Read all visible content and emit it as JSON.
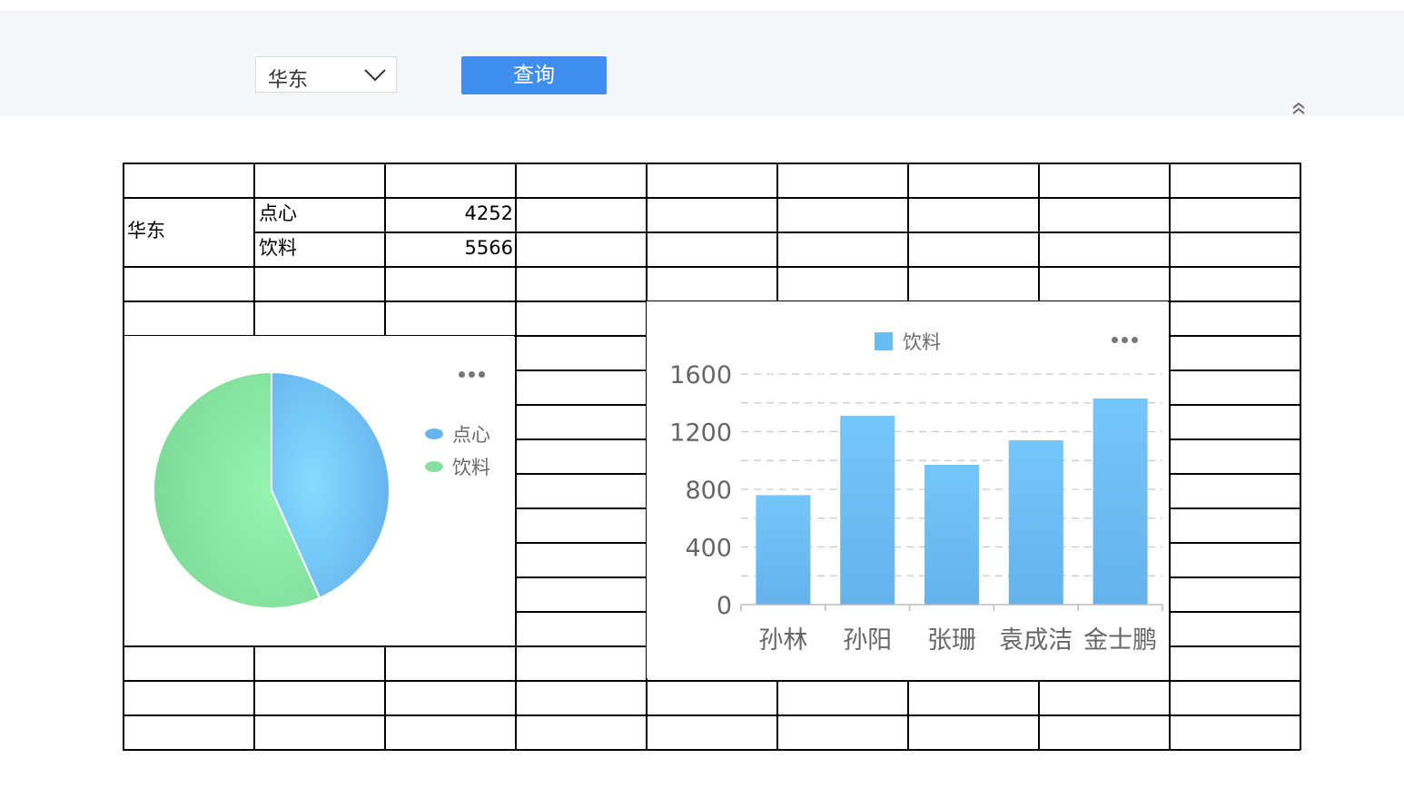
{
  "toolbar": {
    "region_value": "华东",
    "query_label": "查询"
  },
  "report": {
    "region": "华东",
    "rows": [
      {
        "category": "点心",
        "value": "4252"
      },
      {
        "category": "饮料",
        "value": "5566"
      }
    ]
  },
  "chart_data": [
    {
      "type": "pie",
      "series": [
        {
          "name": "点心",
          "value": 4252,
          "color": "#6ab4ee"
        },
        {
          "name": "饮料",
          "value": 5566,
          "color": "#86e0a0"
        }
      ],
      "legend_position": "right"
    },
    {
      "type": "bar",
      "categories": [
        "孙林",
        "孙阳",
        "张珊",
        "袁成洁",
        "金士鹏"
      ],
      "series": [
        {
          "name": "饮料",
          "values": [
            760,
            1310,
            970,
            1140,
            1430
          ],
          "color": "#6cbcf4"
        }
      ],
      "yticks": [
        "0",
        "400",
        "800",
        "1200",
        "1600"
      ],
      "ylim": [
        0,
        1600
      ],
      "grid": true,
      "legend_position": "top"
    }
  ]
}
